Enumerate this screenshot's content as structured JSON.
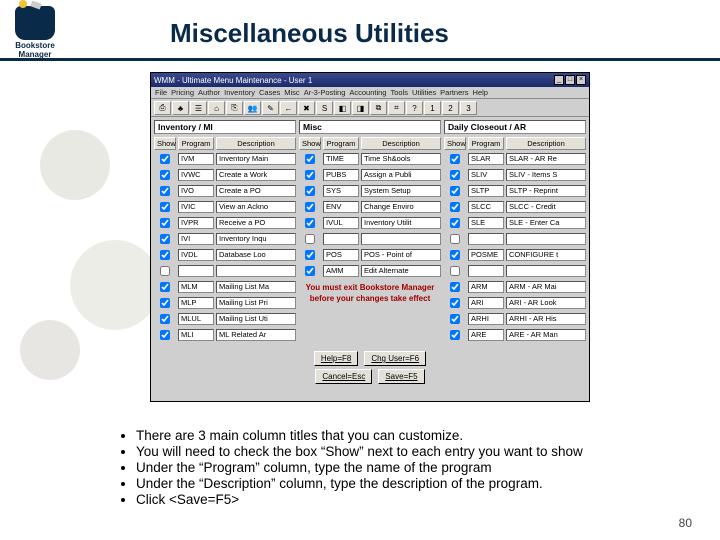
{
  "slide": {
    "title": "Miscellaneous Utilities",
    "logo_top": "Bookstore",
    "logo_bottom": "Manager",
    "page_number": "80"
  },
  "window": {
    "title": "WMM - Ultimate Menu Maintenance - User 1",
    "min": "_",
    "max": "□",
    "close": "×",
    "menu": [
      "File",
      "Pricing",
      "Author",
      "Inventory",
      "Cases",
      "Misc",
      "Ar-3-Posting",
      "Accounting",
      "Tools",
      "Utilities",
      "Partners",
      "Help"
    ]
  },
  "toolbar_icons": [
    "⎙",
    "♣",
    "☰",
    "⌂",
    "⎘",
    "👥",
    "✎",
    "←",
    "✖",
    "S",
    "◧",
    "◨",
    "⧉",
    "⌗",
    "?",
    "1",
    "2",
    "3"
  ],
  "panel_headers": {
    "show": "Show",
    "program": "Program",
    "description": "Description"
  },
  "panels": [
    {
      "title": "Inventory / MI",
      "rows": [
        {
          "show": true,
          "program": "IVM",
          "description": "Inventory Main"
        },
        {
          "show": true,
          "program": "IVWC",
          "description": "Create a Work"
        },
        {
          "show": true,
          "program": "IVO",
          "description": "Create a PO"
        },
        {
          "show": true,
          "program": "IVIC",
          "description": "View an Ackno"
        },
        {
          "show": true,
          "program": "IVPR",
          "description": "Receive a PO"
        },
        {
          "show": true,
          "program": "IVI",
          "description": "Inventory Inqu"
        },
        {
          "show": true,
          "program": "IVDL",
          "description": "Database Loo"
        },
        {
          "show": false,
          "program": "",
          "description": ""
        },
        {
          "show": true,
          "program": "MLM",
          "description": "Mailing List Ma"
        },
        {
          "show": true,
          "program": "MLP",
          "description": "Mailing List Pri"
        },
        {
          "show": true,
          "program": "MLUL",
          "description": "Mailing List Uti"
        },
        {
          "show": true,
          "program": "MLI",
          "description": "ML Related Ar"
        }
      ]
    },
    {
      "title": "Misc",
      "rows": [
        {
          "show": true,
          "program": "TIME",
          "description": "Time Sh&ools"
        },
        {
          "show": true,
          "program": "PUBS",
          "description": "Assign a Publi"
        },
        {
          "show": true,
          "program": "SYS",
          "description": "System Setup"
        },
        {
          "show": true,
          "program": "ENV",
          "description": "Change Enviro"
        },
        {
          "show": true,
          "program": "IVUL",
          "description": "Inventory Utilit"
        },
        {
          "show": false,
          "program": "",
          "description": ""
        },
        {
          "show": true,
          "program": "POS",
          "description": "POS - Point of"
        },
        {
          "show": true,
          "program": "AMM",
          "description": "Edit Alternate"
        }
      ],
      "warning_line1": "You must exit Bookstore Manager",
      "warning_line2": "before your changes take effect"
    },
    {
      "title": "Daily Closeout / AR",
      "rows": [
        {
          "show": true,
          "program": "SLAR",
          "description": "SLAR - AR Re"
        },
        {
          "show": true,
          "program": "SLIV",
          "description": "SLIV - Items S"
        },
        {
          "show": true,
          "program": "SLTP",
          "description": "SLTP - Reprint"
        },
        {
          "show": true,
          "program": "SLCC",
          "description": "SLCC - Credit"
        },
        {
          "show": true,
          "program": "SLE",
          "description": "SLE - Enter Ca"
        },
        {
          "show": false,
          "program": "",
          "description": ""
        },
        {
          "show": true,
          "program": "POSME",
          "description": "CONFIGURE t"
        },
        {
          "show": false,
          "program": "",
          "description": ""
        },
        {
          "show": true,
          "program": "ARM",
          "description": "ARM - AR Mai"
        },
        {
          "show": true,
          "program": "ARI",
          "description": "ARI - AR Look"
        },
        {
          "show": true,
          "program": "ARHI",
          "description": "ARHI - AR His"
        },
        {
          "show": true,
          "program": "ARE",
          "description": "ARE - AR Man"
        }
      ]
    }
  ],
  "buttons": {
    "help": "Help=F8",
    "chg": "Chg User=F6",
    "cancel": "Cancel=Esc",
    "save": "Save=F5"
  },
  "bullets": [
    "There are 3 main column titles that you can customize.",
    "You will need to check the box “Show” next to each entry you want to show",
    "Under the “Program” column, type the name of the program",
    "Under the “Description” column, type the description of the program.",
    "Click <Save=F5>"
  ]
}
